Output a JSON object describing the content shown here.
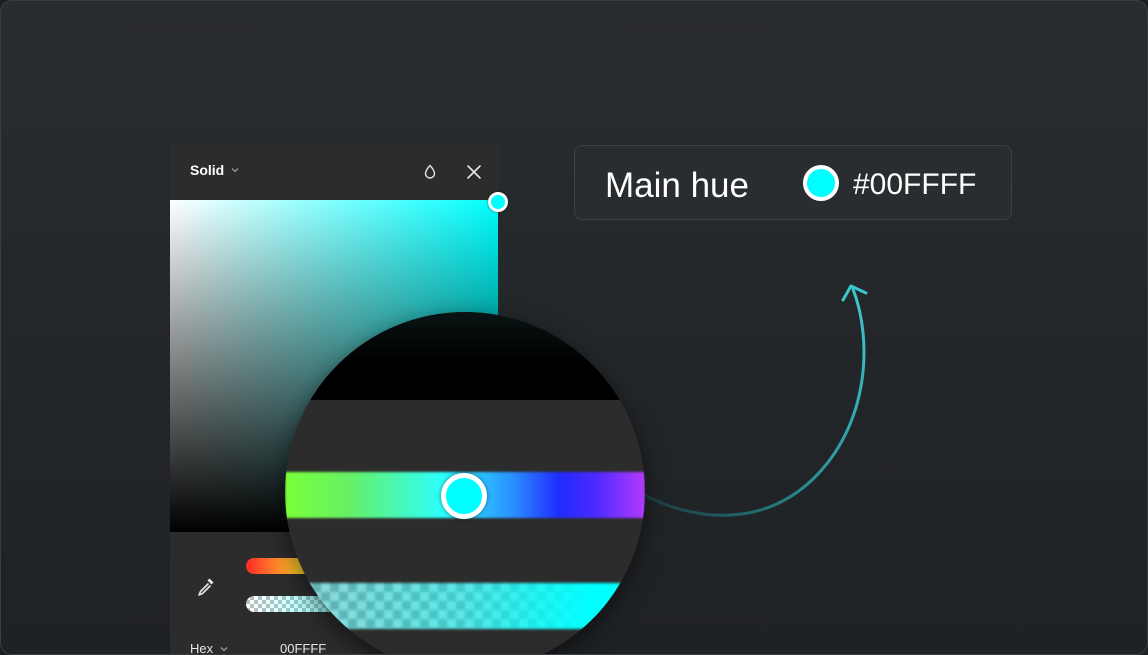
{
  "picker": {
    "mode_label": "Solid",
    "hex_label": "Hex",
    "hex_value": "00FFFF",
    "hue_fraction": 0.5,
    "alpha_percent": 100
  },
  "card": {
    "title": "Main hue",
    "hex": "#00FFFF"
  },
  "colors": {
    "selected": "#00FFFF",
    "arrow": "#3ec6cf",
    "panel_bg": "#2c2c2c"
  },
  "icons": {
    "mode_chevron": "chevron-down-icon",
    "opacity": "drop-icon",
    "close": "close-icon",
    "eyedropper": "eyedropper-icon"
  }
}
